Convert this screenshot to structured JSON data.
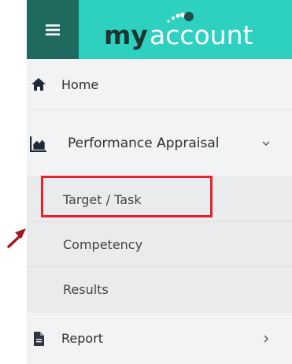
{
  "header": {
    "brand_word1": "my",
    "brand_word2": "account",
    "menu_icon": "hamburger-icon",
    "colors": {
      "toggle_bg": "#1f6a5f",
      "brand_bg": "#2ed0bf"
    }
  },
  "nav": {
    "home": {
      "label": "Home",
      "icon": "home-icon"
    },
    "performance": {
      "label": "Performance Appraisal",
      "icon": "area-chart-icon",
      "expanded": true
    },
    "report": {
      "label": "Report",
      "icon": "document-icon"
    }
  },
  "submenu": {
    "items": [
      {
        "label": "Target / Task",
        "highlighted": true
      },
      {
        "label": "Competency"
      },
      {
        "label": "Results"
      }
    ]
  },
  "annotation": {
    "box_color": "#e8212b",
    "arrow_color": "#a8141c"
  }
}
